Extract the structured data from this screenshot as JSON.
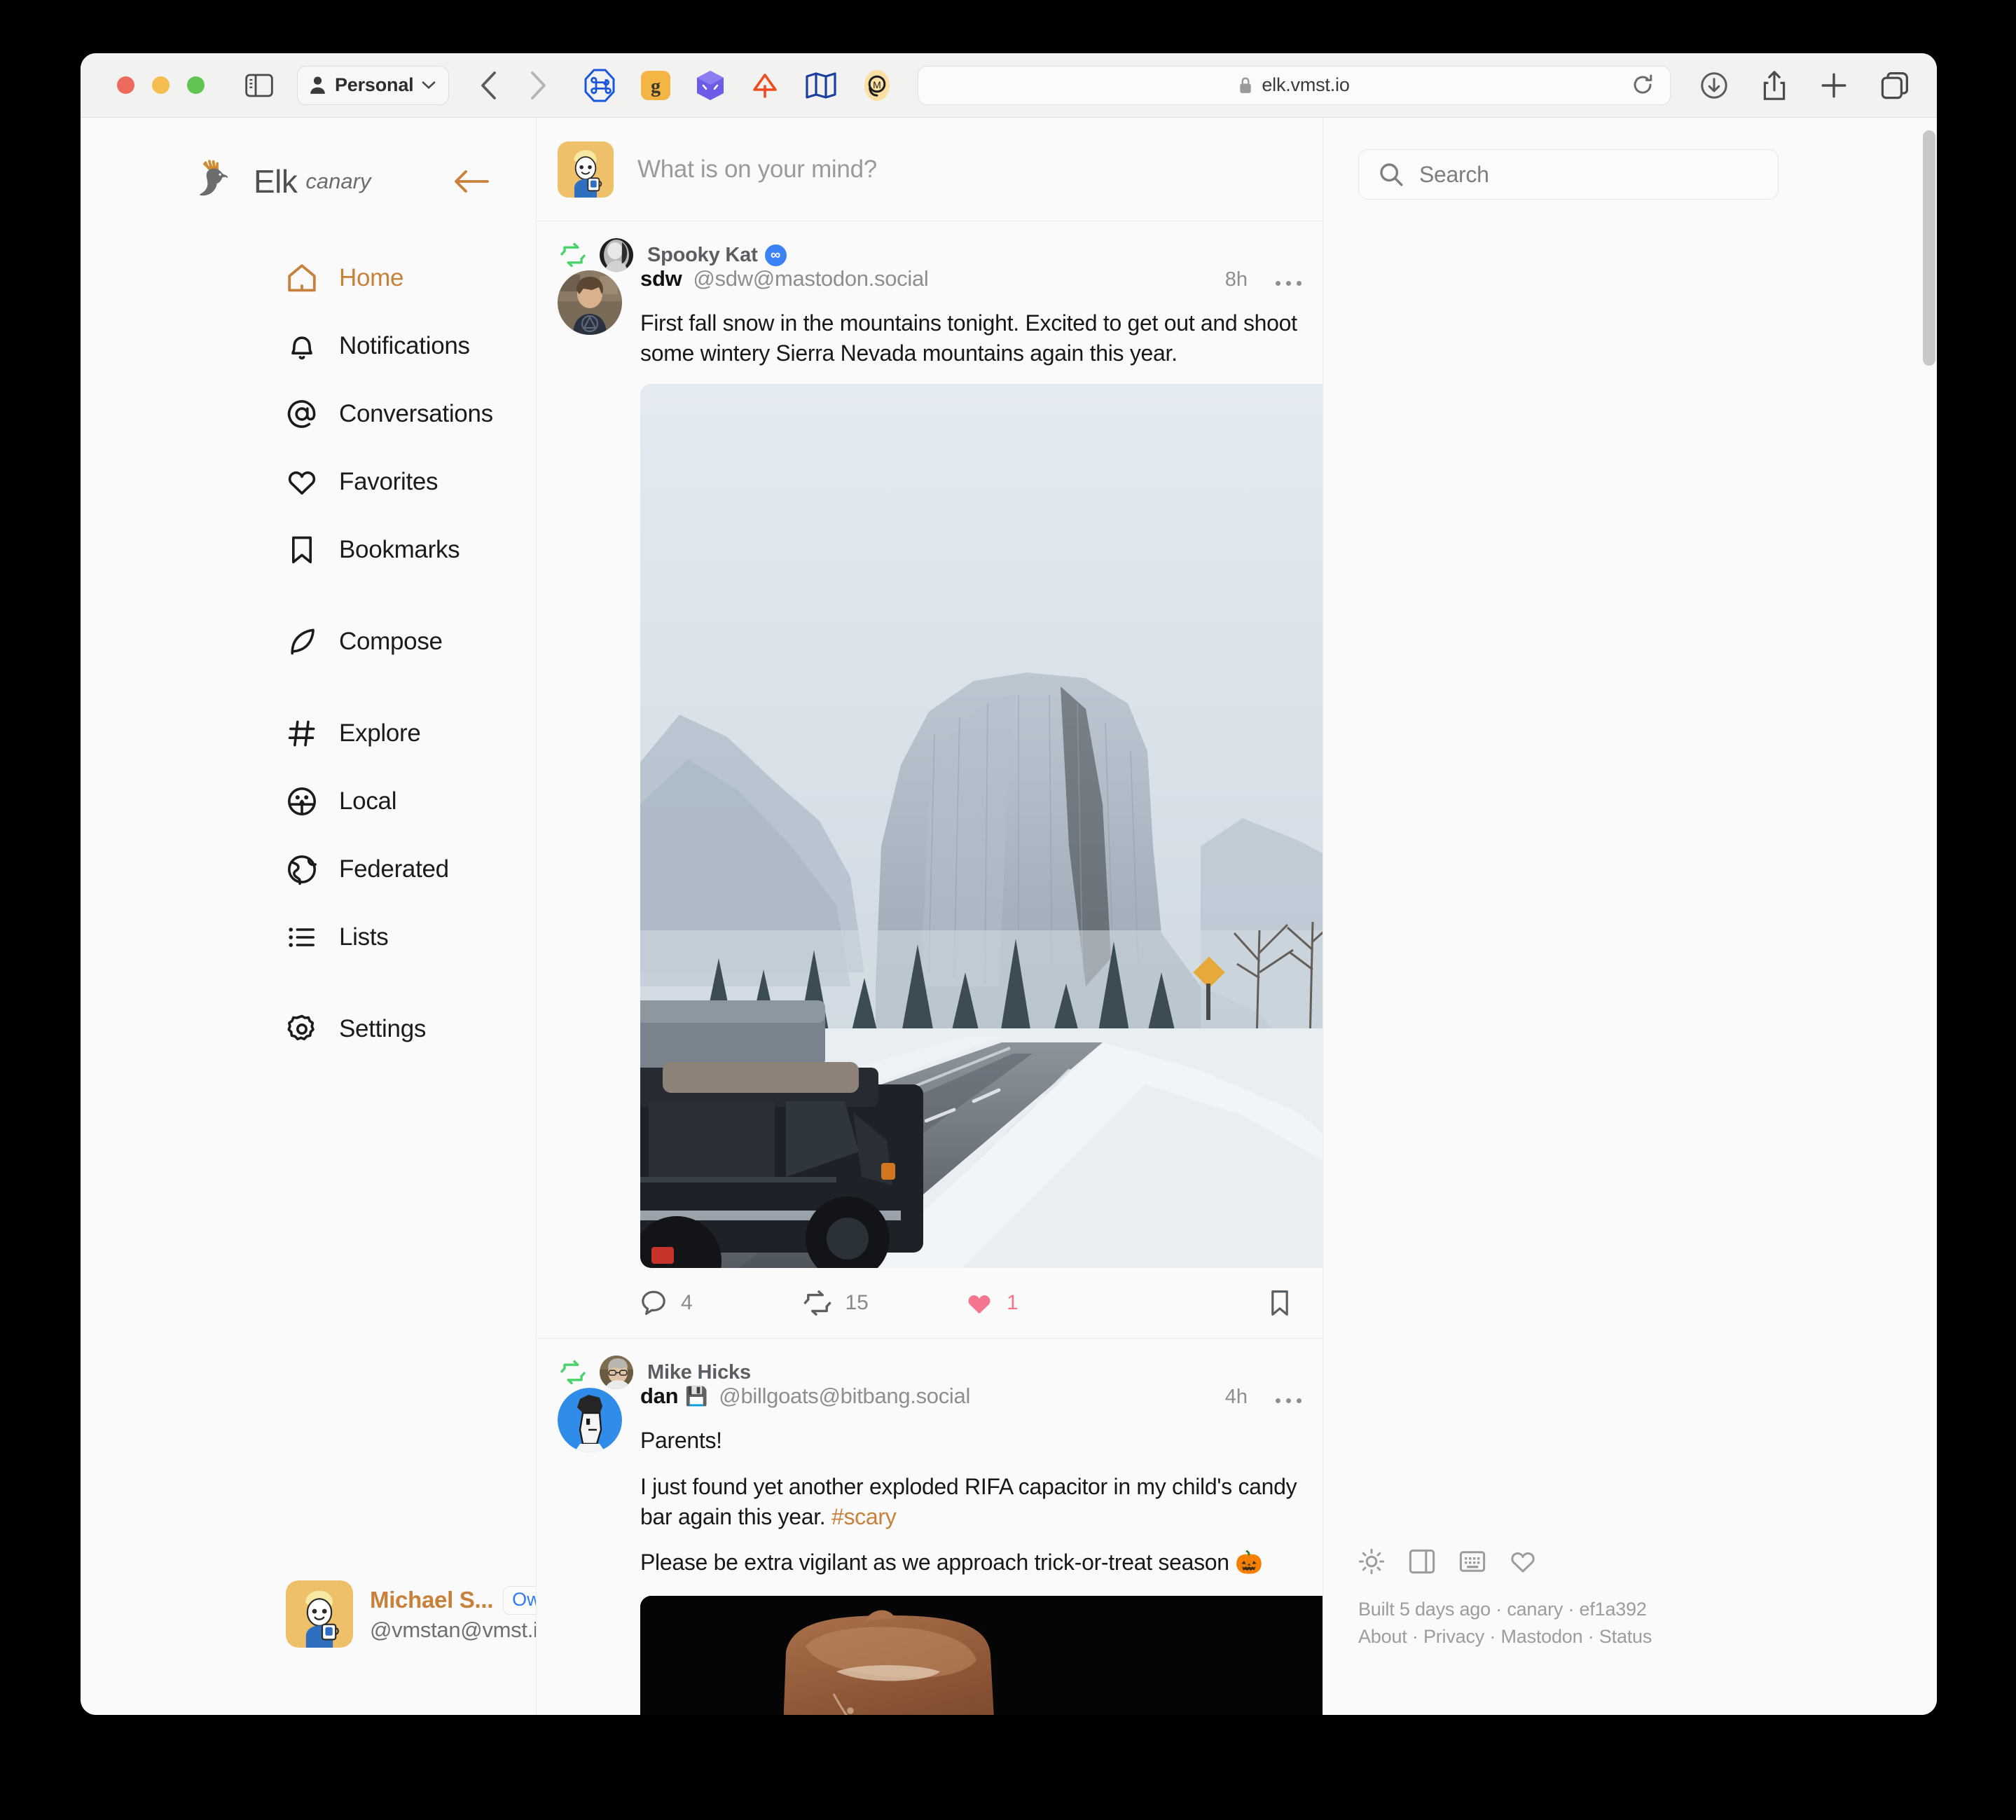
{
  "browser": {
    "profile_label": "Personal",
    "url": "elk.vmst.io",
    "icons": {
      "sidebar_toggle": "sidebar-toggle-icon",
      "person": "person-icon",
      "chevron_down": "chevron-down-icon",
      "back": "back-chevron-icon",
      "forward": "forward-chevron-icon",
      "lock": "lock-icon",
      "reload": "reload-icon",
      "download": "download-icon",
      "share": "share-icon",
      "new_tab": "plus-icon",
      "tab_overview": "tab-overview-icon"
    },
    "extensions": [
      "command-octagon-icon",
      "grammarly-icon",
      "one-password-icon",
      "raycast-icon",
      "map-icon",
      "mastodon-m-icon"
    ]
  },
  "sidebar": {
    "brand": {
      "name": "Elk",
      "tag": "canary"
    },
    "collapse_label": "collapse-sidebar",
    "items": [
      {
        "label": "Home",
        "icon": "home-icon",
        "active": true
      },
      {
        "label": "Notifications",
        "icon": "bell-icon",
        "active": false
      },
      {
        "label": "Conversations",
        "icon": "at-icon",
        "active": false
      },
      {
        "label": "Favorites",
        "icon": "heart-icon",
        "active": false
      },
      {
        "label": "Bookmarks",
        "icon": "bookmark-icon",
        "active": false
      },
      {
        "label": "Compose",
        "icon": "feather-icon",
        "active": false
      },
      {
        "label": "Explore",
        "icon": "hash-icon",
        "active": false
      },
      {
        "label": "Local",
        "icon": "local-people-icon",
        "active": false
      },
      {
        "label": "Federated",
        "icon": "globe-icon",
        "active": false
      },
      {
        "label": "Lists",
        "icon": "list-icon",
        "active": false
      },
      {
        "label": "Settings",
        "icon": "gear-icon",
        "active": false
      }
    ],
    "user": {
      "display_name": "Michael S...",
      "badge": "Owner",
      "handle": "@vmstan@vmst.io",
      "menu_icon": "kebab-menu-icon"
    }
  },
  "composer": {
    "placeholder": "What is on your mind?"
  },
  "feed": {
    "posts": [
      {
        "boosted_by": "Spooky Kat",
        "boost_badge": "∞",
        "display_name": "sdw",
        "handle": "@sdw@mastodon.social",
        "time": "8h",
        "text": "First fall snow in the mountains tonight. Excited to get out and shoot some wintery Sierra Nevada mountains again this year.",
        "media": "snowy-yosemite-el-capitan-photo",
        "actions": {
          "reply_count": "4",
          "boost_count": "15",
          "favorite_count": "1",
          "bookmark": ""
        }
      },
      {
        "boosted_by": "Mike Hicks",
        "display_name": "dan",
        "name_emoji": "💾",
        "handle": "@billgoats@bitbang.social",
        "time": "4h",
        "line1": "Parents!",
        "line2_a": "I just found yet another exploded RIFA capacitor in my child's candy bar again this year. ",
        "line2_tag": "#scary",
        "line3": "Please be extra vigilant as we approach trick-or-treat season 🎃",
        "media": "chocolate-candy-bar-photo"
      }
    ]
  },
  "search": {
    "placeholder": "Search",
    "icon": "search-icon"
  },
  "right_footer": {
    "icons": [
      "sun-icon",
      "layout-panel-icon",
      "keyboard-icon",
      "heart-outline-icon"
    ],
    "build_line": "Built 5 days ago · canary · ef1a392",
    "links": [
      "About",
      "Privacy",
      "Mastodon",
      "Status"
    ],
    "links_joined": "About · Privacy · Mastodon · Status"
  },
  "colors": {
    "accent": "#c8813a",
    "boost_green": "#4ad36a",
    "like_pink": "#f4758d",
    "link_blue": "#2f7bf6"
  }
}
